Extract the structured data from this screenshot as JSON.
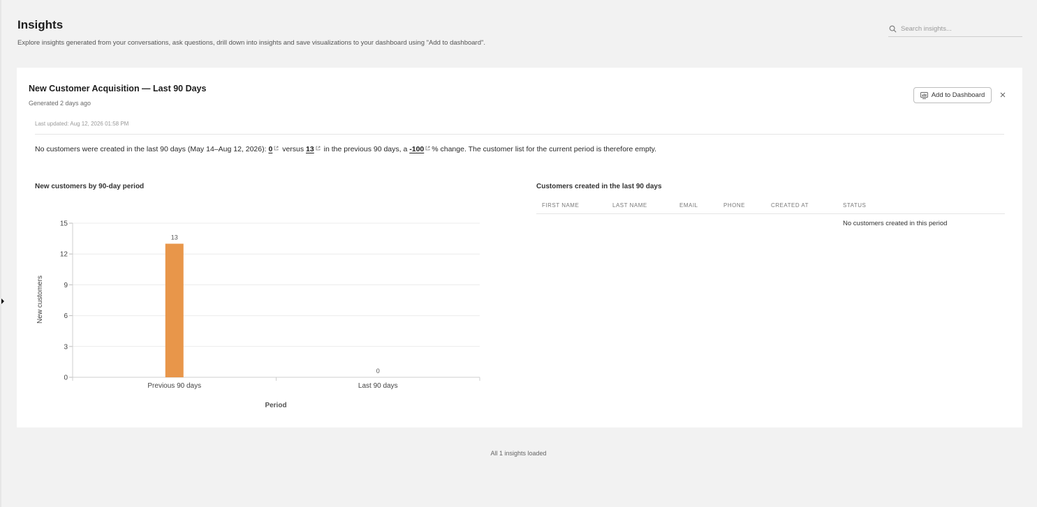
{
  "header": {
    "title": "Insights",
    "description": "Explore insights generated from your conversations, ask questions, drill down into insights and save visualizations to your dashboard using \"Add to dashboard\".",
    "search_placeholder": "Search insights..."
  },
  "card": {
    "title": "New Customer Acquisition — Last 90 Days",
    "generated": "Generated 2 days ago",
    "add_button_label": "Add to Dashboard",
    "last_updated": "Last updated: Aug 12, 2026 01:58 PM",
    "summary": {
      "part1": "No customers were created in the last 90 days (May 14–Aug 12, 2026): ",
      "value_current": "0",
      "part2": " versus ",
      "value_previous": "13",
      "part3": " in the previous 90 days, a ",
      "value_change": "-100",
      "part4": "% change. The customer list for the current period is therefore empty."
    }
  },
  "chart_data": {
    "type": "bar",
    "title": "New customers by 90-day period",
    "categories": [
      "Previous 90 days",
      "Last 90 days"
    ],
    "values": [
      13,
      0
    ],
    "xlabel": "Period",
    "ylabel": "New customers",
    "ylim": [
      0,
      15
    ],
    "yticks": [
      0,
      3,
      6,
      9,
      12,
      15
    ],
    "bar_color": "#e8964a",
    "grid": true,
    "data_labels": true
  },
  "table": {
    "title": "Customers created in the last 90 days",
    "columns": [
      "FIRST NAME",
      "LAST NAME",
      "EMAIL",
      "PHONE",
      "CREATED AT",
      "STATUS"
    ],
    "rows": [],
    "empty_message": "No customers created in this period"
  },
  "footer": {
    "status": "All 1 insights loaded"
  },
  "colors": {
    "background": "#f2f2f2",
    "card": "#ffffff",
    "bar": "#e8964a"
  }
}
